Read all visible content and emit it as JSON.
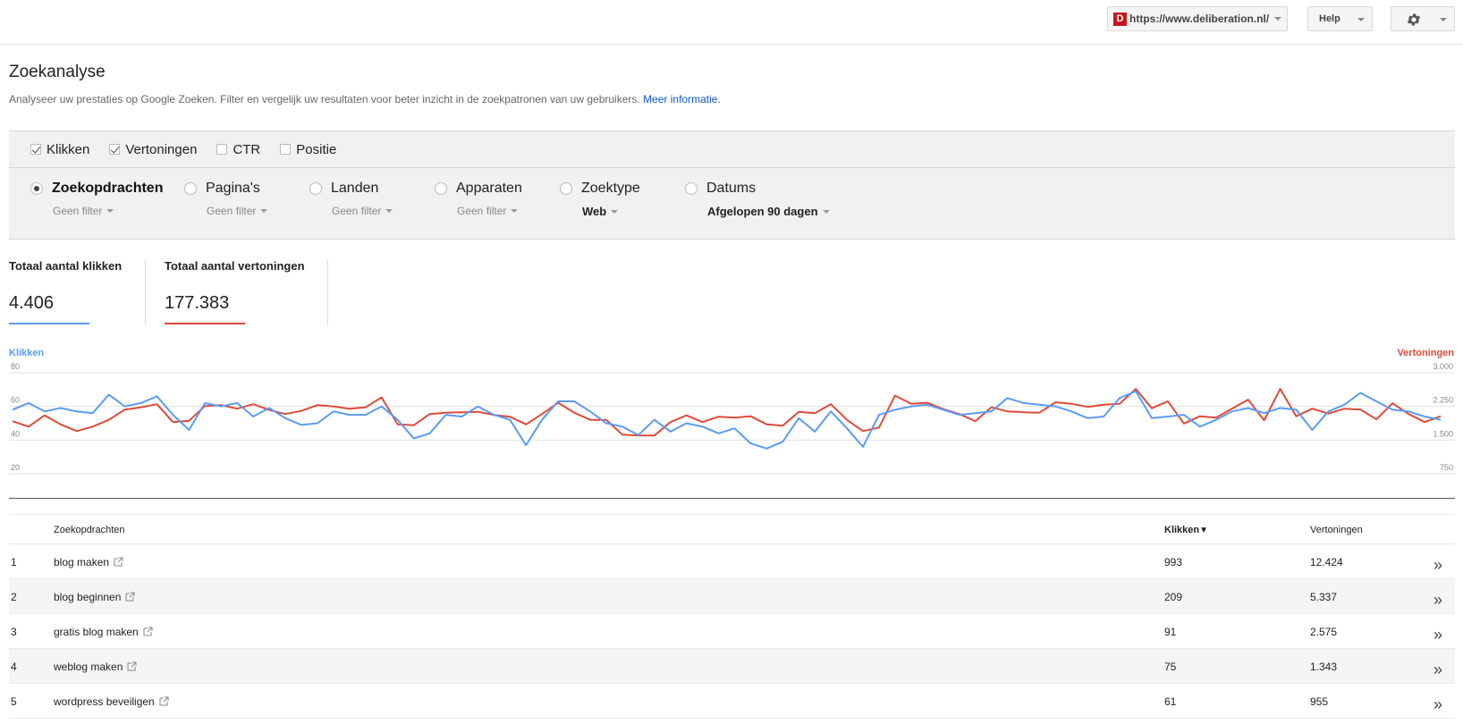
{
  "topbar": {
    "site_favicon": "D",
    "site_url": "https://www.deliberation.nl/",
    "help_label": "Help",
    "settings_icon": "gear-icon"
  },
  "header": {
    "title": "Zoekanalyse",
    "description": "Analyseer uw prestaties op Google Zoeken. Filter en vergelijk uw resultaten voor beter inzicht in de zoekpatronen van uw gebruikers.",
    "more_link": "Meer informatie."
  },
  "metrics": [
    {
      "label": "Klikken",
      "checked": true
    },
    {
      "label": "Vertoningen",
      "checked": true
    },
    {
      "label": "CTR",
      "checked": false
    },
    {
      "label": "Positie",
      "checked": false
    }
  ],
  "dimensions": [
    {
      "label": "Zoekopdrachten",
      "filter": "Geen filter",
      "selected": true
    },
    {
      "label": "Pagina's",
      "filter": "Geen filter",
      "selected": false
    },
    {
      "label": "Landen",
      "filter": "Geen filter",
      "selected": false
    },
    {
      "label": "Apparaten",
      "filter": "Geen filter",
      "selected": false
    },
    {
      "label": "Zoektype",
      "filter": "Web",
      "selected": false
    },
    {
      "label": "Datums",
      "filter": "Afgelopen 90 dagen",
      "selected": false
    }
  ],
  "totals": {
    "clicks_label": "Totaal aantal klikken",
    "clicks_value": "4.406",
    "impressions_label": "Totaal aantal vertoningen",
    "impressions_value": "177.383"
  },
  "colors": {
    "clicks": "#5b9bf3",
    "impressions": "#dd4b39"
  },
  "chart_data": {
    "type": "line",
    "left_axis_label": "Klikken",
    "right_axis_label": "Vertoningen",
    "left_ticks": [
      "80",
      "60",
      "40",
      "20"
    ],
    "right_ticks": [
      "3.000",
      "2.250",
      "1.500",
      "750"
    ],
    "left_ylim": [
      20,
      80
    ],
    "right_ylim": [
      750,
      3000
    ],
    "grid": true,
    "series": [
      {
        "name": "Klikken",
        "axis": "left",
        "values": [
          58,
          62,
          57,
          59,
          57,
          56,
          67,
          60,
          62,
          66,
          55,
          46,
          62,
          60,
          62,
          54,
          59,
          53,
          49,
          50,
          57,
          55,
          55,
          60,
          52,
          41,
          44,
          55,
          54,
          60,
          55,
          52,
          37,
          52,
          63,
          63,
          57,
          50,
          48,
          43,
          52,
          45,
          50,
          48,
          44,
          47,
          38,
          35,
          39,
          53,
          45,
          57,
          47,
          36,
          55,
          58,
          60,
          61,
          58,
          55,
          56,
          57,
          65,
          62,
          61,
          60,
          57,
          53,
          54,
          65,
          69,
          53,
          54,
          55,
          48,
          52,
          57,
          59,
          56,
          59,
          58,
          46,
          57,
          61,
          68,
          63,
          58,
          57,
          54,
          52
        ]
      },
      {
        "name": "Vertoningen",
        "axis": "right",
        "values": [
          1920,
          1800,
          2050,
          1850,
          1700,
          1800,
          1950,
          2180,
          2230,
          2300,
          1900,
          1930,
          2260,
          2280,
          2200,
          2300,
          2170,
          2080,
          2150,
          2280,
          2250,
          2200,
          2230,
          2450,
          1850,
          1830,
          2080,
          2110,
          2120,
          2130,
          2060,
          2020,
          1850,
          2080,
          2330,
          2110,
          1950,
          1950,
          1620,
          1600,
          1600,
          1900,
          2050,
          1900,
          2020,
          2000,
          2030,
          1850,
          1820,
          2130,
          2100,
          2300,
          1950,
          1700,
          1780,
          2490,
          2310,
          2330,
          2190,
          2080,
          1920,
          2230,
          2140,
          2120,
          2110,
          2340,
          2310,
          2240,
          2290,
          2310,
          2640,
          2210,
          2360,
          1870,
          2030,
          2000,
          2200,
          2400,
          1940,
          2640,
          2030,
          2200,
          2090,
          2200,
          2180,
          1960,
          2320,
          2080,
          1900,
          2030
        ]
      }
    ]
  },
  "table": {
    "headers": {
      "query": "Zoekopdrachten",
      "clicks": "Klikken",
      "impressions": "Vertoningen"
    },
    "rows": [
      {
        "rank": "1",
        "query": "blog maken",
        "clicks": "993",
        "impressions": "12.424"
      },
      {
        "rank": "2",
        "query": "blog beginnen",
        "clicks": "209",
        "impressions": "5.337"
      },
      {
        "rank": "3",
        "query": "gratis blog maken",
        "clicks": "91",
        "impressions": "2.575"
      },
      {
        "rank": "4",
        "query": "weblog maken",
        "clicks": "75",
        "impressions": "1.343"
      },
      {
        "rank": "5",
        "query": "wordpress beveiligen",
        "clicks": "61",
        "impressions": "955"
      }
    ]
  }
}
